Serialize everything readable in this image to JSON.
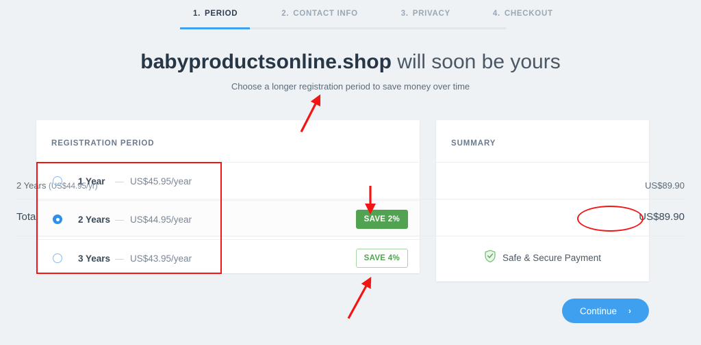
{
  "stepper": {
    "steps": [
      {
        "num": "1.",
        "label": "PERIOD",
        "active": true
      },
      {
        "num": "2.",
        "label": "CONTACT INFO",
        "active": false
      },
      {
        "num": "3.",
        "label": "PRIVACY",
        "active": false
      },
      {
        "num": "4.",
        "label": "CHECKOUT",
        "active": false
      }
    ],
    "progress_percent": 21,
    "active_color": "#3fa0ef",
    "track_color": "#e2e6ea"
  },
  "heading": {
    "domain": "babyproductsonline.shop",
    "rest": " will soon be yours",
    "subtitle": "Choose a longer registration period to save money over time"
  },
  "period_card": {
    "title": "REGISTRATION PERIOD",
    "options": [
      {
        "name": "1 Year",
        "dash": "—",
        "price": "US$45.95/year",
        "selected": false,
        "badge": null
      },
      {
        "name": "2 Years",
        "dash": "—",
        "price": "US$44.95/year",
        "selected": true,
        "badge": "SAVE 2%"
      },
      {
        "name": "3 Years",
        "dash": "—",
        "price": "US$43.95/year",
        "selected": false,
        "badge": "SAVE 4%"
      }
    ]
  },
  "summary_card": {
    "title": "SUMMARY",
    "line_label": "2 Years ",
    "line_label_sub": "(US$44.95/yr)",
    "line_value": "US$89.90",
    "total_label": "Total",
    "total_value": "US$89.90",
    "secure_text": "Safe & Secure Payment"
  },
  "continue_button": {
    "label": "Continue",
    "chevron": "›",
    "color": "#3fa0ef"
  },
  "annotations": {
    "color": "#f31414",
    "rect_target": "registration-period-options",
    "ellipse_target": "total-price",
    "arrows": [
      {
        "name": "arrow-to-subtitle",
        "direction": "up-right"
      },
      {
        "name": "arrow-to-save-2-badge",
        "direction": "down"
      },
      {
        "name": "arrow-to-save-4-badge",
        "direction": "up-right"
      }
    ]
  },
  "colors": {
    "page_background": "#eff2f5",
    "card_background": "#ffffff",
    "badge_solid_green": "#51a351",
    "badge_outline_green": "#51a351",
    "radio_selected": "#2f90e8"
  }
}
